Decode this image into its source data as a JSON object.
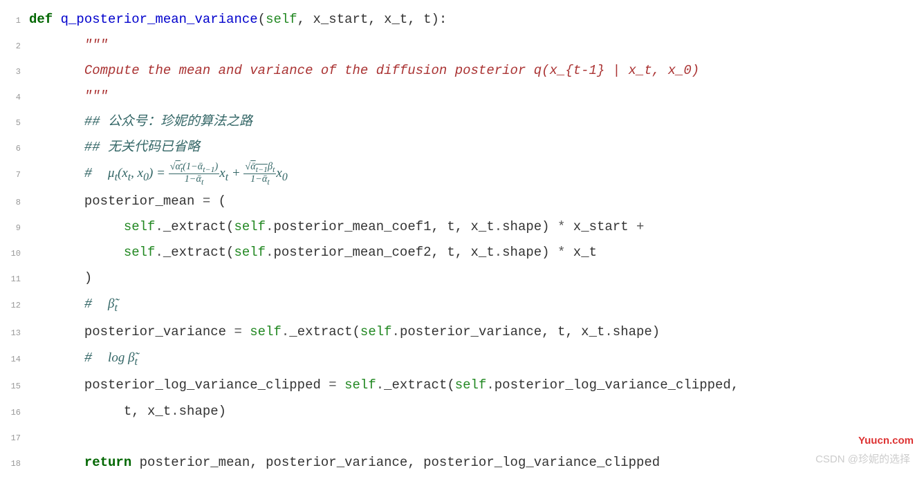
{
  "lines": [
    {
      "n": "1",
      "indent": 0,
      "type": "def",
      "parts": {
        "def": "def",
        "fname": "q_posterior_mean_variance",
        "lp": "(",
        "args": [
          {
            "t": "self",
            "s": "self"
          },
          {
            "t": "plain",
            "s": ", x_start, x_t, t"
          }
        ],
        "rp": "):"
      }
    },
    {
      "n": "2",
      "indent": 1,
      "type": "docstr",
      "text": "\"\"\""
    },
    {
      "n": "3",
      "indent": 1,
      "type": "docstr",
      "text": "Compute the mean and variance of the diffusion posterior q(x_{t-1} | x_t, x_0)"
    },
    {
      "n": "4",
      "indent": 1,
      "type": "docstr",
      "text": "\"\"\""
    },
    {
      "n": "5",
      "indent": 1,
      "type": "comment",
      "text": "## 公众号：珍妮的算法之路"
    },
    {
      "n": "6",
      "indent": 1,
      "type": "comment",
      "text": "## 无关代码已省略"
    },
    {
      "n": "7",
      "indent": 1,
      "type": "math",
      "prefix": "#  ",
      "formula": "mu"
    },
    {
      "n": "8",
      "indent": 1,
      "type": "code",
      "tokens": [
        {
          "t": "plain",
          "s": "posterior_mean "
        },
        {
          "t": "op",
          "s": "="
        },
        {
          "t": "plain",
          "s": " ("
        }
      ]
    },
    {
      "n": "9",
      "indent": 2,
      "type": "code",
      "tokens": [
        {
          "t": "self",
          "s": "self"
        },
        {
          "t": "op",
          "s": "."
        },
        {
          "t": "plain",
          "s": "_extract("
        },
        {
          "t": "self",
          "s": "self"
        },
        {
          "t": "op",
          "s": "."
        },
        {
          "t": "plain",
          "s": "posterior_mean_coef1, t, x_t"
        },
        {
          "t": "op",
          "s": "."
        },
        {
          "t": "plain",
          "s": "shape) "
        },
        {
          "t": "op",
          "s": "*"
        },
        {
          "t": "plain",
          "s": " x_start "
        },
        {
          "t": "op",
          "s": "+"
        }
      ]
    },
    {
      "n": "10",
      "indent": 2,
      "type": "code",
      "tokens": [
        {
          "t": "self",
          "s": "self"
        },
        {
          "t": "op",
          "s": "."
        },
        {
          "t": "plain",
          "s": "_extract("
        },
        {
          "t": "self",
          "s": "self"
        },
        {
          "t": "op",
          "s": "."
        },
        {
          "t": "plain",
          "s": "posterior_mean_coef2, t, x_t"
        },
        {
          "t": "op",
          "s": "."
        },
        {
          "t": "plain",
          "s": "shape) "
        },
        {
          "t": "op",
          "s": "*"
        },
        {
          "t": "plain",
          "s": " x_t"
        }
      ]
    },
    {
      "n": "11",
      "indent": 1,
      "type": "code",
      "tokens": [
        {
          "t": "plain",
          "s": ")"
        }
      ]
    },
    {
      "n": "12",
      "indent": 1,
      "type": "math",
      "prefix": "#  ",
      "formula": "beta"
    },
    {
      "n": "13",
      "indent": 1,
      "type": "code",
      "tokens": [
        {
          "t": "plain",
          "s": "posterior_variance "
        },
        {
          "t": "op",
          "s": "="
        },
        {
          "t": "plain",
          "s": " "
        },
        {
          "t": "self",
          "s": "self"
        },
        {
          "t": "op",
          "s": "."
        },
        {
          "t": "plain",
          "s": "_extract("
        },
        {
          "t": "self",
          "s": "self"
        },
        {
          "t": "op",
          "s": "."
        },
        {
          "t": "plain",
          "s": "posterior_variance, t, x_t"
        },
        {
          "t": "op",
          "s": "."
        },
        {
          "t": "plain",
          "s": "shape)"
        }
      ]
    },
    {
      "n": "14",
      "indent": 1,
      "type": "math",
      "prefix": "#  ",
      "formula": "logbeta"
    },
    {
      "n": "15",
      "indent": 1,
      "type": "code",
      "tokens": [
        {
          "t": "plain",
          "s": "posterior_log_variance_clipped "
        },
        {
          "t": "op",
          "s": "="
        },
        {
          "t": "plain",
          "s": " "
        },
        {
          "t": "self",
          "s": "self"
        },
        {
          "t": "op",
          "s": "."
        },
        {
          "t": "plain",
          "s": "_extract("
        },
        {
          "t": "self",
          "s": "self"
        },
        {
          "t": "op",
          "s": "."
        },
        {
          "t": "plain",
          "s": "posterior_log_variance_clipped,"
        }
      ]
    },
    {
      "n": "16",
      "indent": 2,
      "type": "code",
      "tokens": [
        {
          "t": "plain",
          "s": "t, x_t"
        },
        {
          "t": "op",
          "s": "."
        },
        {
          "t": "plain",
          "s": "shape)"
        }
      ]
    },
    {
      "n": "17",
      "indent": 0,
      "type": "blank"
    },
    {
      "n": "18",
      "indent": 1,
      "type": "code",
      "tokens": [
        {
          "t": "kw",
          "s": "return"
        },
        {
          "t": "plain",
          "s": " posterior_mean, posterior_variance, posterior_log_variance_clipped"
        }
      ]
    }
  ],
  "watermarks": {
    "yuucn": "Yuucn.com",
    "csdn": "CSDN @珍妮的选择"
  }
}
